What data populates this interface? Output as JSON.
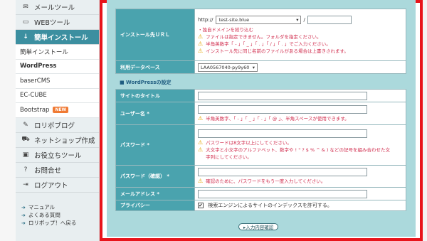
{
  "sidebar": {
    "items": [
      {
        "icon": "mail-icon",
        "glyph": "✉",
        "label": "メールツール"
      },
      {
        "icon": "monitor-icon",
        "glyph": "▭",
        "label": "WEBツール"
      },
      {
        "icon": "download-icon",
        "glyph": "↓",
        "label": "簡単インストール"
      }
    ],
    "sub_items": [
      {
        "label": "簡単インストール"
      },
      {
        "label": "WordPress"
      },
      {
        "label": "baserCMS"
      },
      {
        "label": "EC-CUBE"
      },
      {
        "label": "Bootstrap",
        "badge": "NEW"
      }
    ],
    "items_after": [
      {
        "icon": "pencil-icon",
        "glyph": "✎",
        "label": "ロリポブログ"
      },
      {
        "icon": "cart-icon",
        "glyph": "⛟",
        "label": "ネットショップ作成"
      },
      {
        "icon": "briefcase-icon",
        "glyph": "▣",
        "label": "お役立ちツール"
      },
      {
        "icon": "question-icon",
        "glyph": "?",
        "label": "お問合せ"
      },
      {
        "icon": "logout-icon",
        "glyph": "⇥",
        "label": "ログアウト"
      }
    ],
    "links": [
      "マニュアル",
      "よくある質問",
      "ロリポップ！へ戻る"
    ]
  },
  "form": {
    "install_url": {
      "label": "インストール先ＵＲＬ",
      "prefix": "http://",
      "domain": "test-site.blue",
      "separator": "/",
      "path_value": "",
      "link": "・独自ドメインを絞り込む",
      "warnings": [
        "ファイルは指定できません。フォルダを指定ください。",
        "半角英数字「 - 」「 _ 」「 . 」「 / 」「 . 」でご入力ください。",
        "インストール先に同じ名前のファイルがある場合は上書きされます。"
      ]
    },
    "database": {
      "label": "利用データベース",
      "value": "LAA0567040-py9y60"
    },
    "section_title": "■ WordPressの設定",
    "site_title": {
      "label": "サイトのタイトル",
      "value": ""
    },
    "username": {
      "label": "ユーザー名 *",
      "value": "",
      "warnings": [
        "半角英数字、「 - 」「 _ 」「 . 」「 @ 」、半角スペースが使用できます。"
      ]
    },
    "password": {
      "label": "パスワード *",
      "value": "",
      "warnings": [
        "パスワードは8文字以上にしてください。",
        "大文字と小文字のアルファベット、数字や ! \" ? $ % ^ & ) などの記号を組み合わせた文字列にしてください。"
      ]
    },
    "password_confirm": {
      "label": "パスワード（確認） *",
      "value": "",
      "warnings": [
        "確認のために、パスワードをもう一度入力してください。"
      ]
    },
    "email": {
      "label": "メールアドレス *",
      "value": ""
    },
    "privacy": {
      "label": "プライバシー",
      "checked": true,
      "text": "検索エンジンによるサイトのインデックスを許可する。"
    },
    "submit_label": "▸入力内容確認"
  },
  "colors": {
    "accent": "#4aa3ae",
    "active_nav": "#3c8fa0",
    "frame": "#e8141b",
    "panel": "#abd9dc",
    "warning_text": "#d02a4b"
  }
}
